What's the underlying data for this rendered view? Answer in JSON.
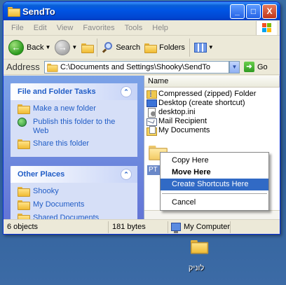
{
  "window": {
    "title": "SendTo",
    "minimize": "_",
    "maximize": "□",
    "close": "X"
  },
  "menu": [
    "File",
    "Edit",
    "View",
    "Favorites",
    "Tools",
    "Help"
  ],
  "toolbar": {
    "back": "Back",
    "search": "Search",
    "folders": "Folders"
  },
  "address": {
    "label": "Address",
    "path": "C:\\Documents and Settings\\Shooky\\SendTo",
    "go": "Go"
  },
  "tasks": {
    "file_folder": {
      "title": "File and Folder Tasks",
      "items": [
        "Make a new folder",
        "Publish this folder to the Web",
        "Share this folder"
      ]
    },
    "other_places": {
      "title": "Other Places",
      "items": [
        "Shooky",
        "My Documents",
        "Shared Documents"
      ]
    }
  },
  "filepane": {
    "column_name": "Name",
    "files": [
      {
        "name": "Compressed (zipped) Folder",
        "icon": "zip-folder-icon"
      },
      {
        "name": "Desktop (create shortcut)",
        "icon": "desktop-icon"
      },
      {
        "name": "desktop.ini",
        "icon": "ini-file-icon"
      },
      {
        "name": "Mail Recipient",
        "icon": "mail-icon"
      },
      {
        "name": "My Documents",
        "icon": "my-documents-icon"
      }
    ],
    "drag_label": "PT"
  },
  "context_menu": {
    "items": [
      "Copy Here",
      "Move Here",
      "Create Shortcuts Here",
      "Cancel"
    ],
    "selected": "Create Shortcuts Here"
  },
  "status": {
    "objects": "6 objects",
    "size": "181 bytes",
    "location": "My Computer"
  },
  "desktop": {
    "folder_label": "לוניק"
  },
  "colors": {
    "title_blue": "#0054e3",
    "task_link": "#215dc6",
    "selection": "#316ac5"
  }
}
